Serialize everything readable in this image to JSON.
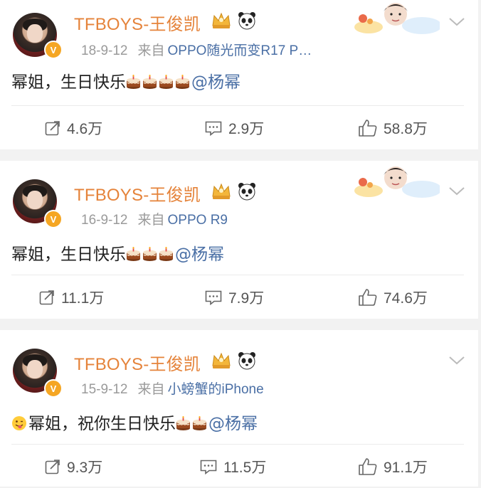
{
  "posts": [
    {
      "username": "TFBOYS-王俊凯",
      "date": "18-9-12",
      "from_label": "来自",
      "source": "OPPO随光而变R17 P…",
      "text_main": "幂姐，生日快乐",
      "cake_count": 4,
      "mention": "@杨幂",
      "leading_emoji": false,
      "reposts": "4.6万",
      "comments": "2.9万",
      "likes": "58.8万"
    },
    {
      "username": "TFBOYS-王俊凯",
      "date": "16-9-12",
      "from_label": "来自",
      "source": "OPPO R9",
      "text_main": "幂姐，生日快乐",
      "cake_count": 3,
      "mention": "@杨幂",
      "leading_emoji": false,
      "reposts": "11.1万",
      "comments": "7.9万",
      "likes": "74.6万"
    },
    {
      "username": "TFBOYS-王俊凯",
      "date": "15-9-12",
      "from_label": "来自",
      "source": "小螃蟹的iPhone",
      "text_main": "幂姐，祝你生日快乐",
      "cake_count": 2,
      "mention": "@杨幂",
      "leading_emoji": true,
      "reposts": "9.3万",
      "comments": "11.5万",
      "likes": "91.1万"
    }
  ],
  "colors": {
    "username": "#e5833a",
    "link": "#4a6fa5",
    "meta": "#9a9a9a",
    "text": "#222222",
    "verified": "#f5a623"
  },
  "icons": [
    "crown-icon",
    "panda-icon",
    "chevron-down-icon",
    "repost-icon",
    "comment-icon",
    "like-icon",
    "cake-emoji",
    "tongue-face-emoji",
    "verified-v-icon"
  ]
}
